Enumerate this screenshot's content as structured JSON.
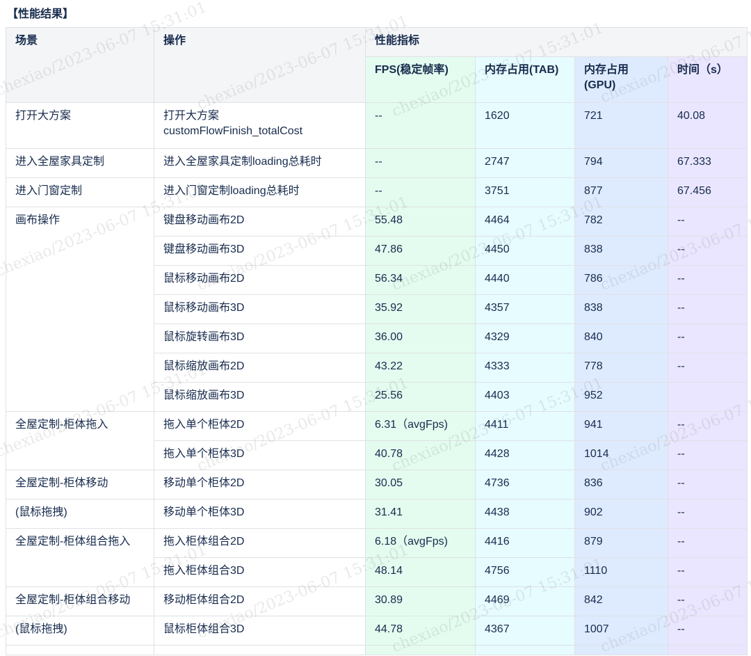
{
  "heading": "【性能结果】",
  "table": {
    "headers": {
      "scene": "场景",
      "operation": "操作",
      "metrics": "性能指标",
      "fps": "FPS(稳定帧率)",
      "mem_tab": "内存占用(TAB)",
      "mem_gpu": "内存占用\n(GPU)",
      "time": "时间（s）"
    },
    "rows": [
      {
        "scene": "打开大方案",
        "op": "打开大方案\ncustomFlowFinish_totalCost",
        "fps": "--",
        "tab": "1620",
        "gpu": "721",
        "time": "40.08"
      },
      {
        "scene": "进入全屋家具定制",
        "op": "进入全屋家具定制loading总耗时",
        "fps": "--",
        "tab": "2747",
        "gpu": "794",
        "time": "67.333"
      },
      {
        "scene": "进入门窗定制",
        "op": "进入门窗定制loading总耗时",
        "fps": "--",
        "tab": "3751",
        "gpu": "877",
        "time": "67.456"
      },
      {
        "scene": "画布操作",
        "op": "键盘移动画布2D",
        "fps": "55.48",
        "tab": "4464",
        "gpu": "782",
        "time": "--"
      },
      {
        "scene": "",
        "op": "键盘移动画布3D",
        "fps": "47.86",
        "tab": "4450",
        "gpu": "838",
        "time": "--"
      },
      {
        "scene": "",
        "op": "鼠标移动画布2D",
        "fps": "56.34",
        "tab": "4440",
        "gpu": "786",
        "time": "--"
      },
      {
        "scene": "",
        "op": "鼠标移动画布3D",
        "fps": "35.92",
        "tab": "4357",
        "gpu": "838",
        "time": "--"
      },
      {
        "scene": "",
        "op": "鼠标旋转画布3D",
        "fps": "36.00",
        "tab": "4329",
        "gpu": "840",
        "time": "--"
      },
      {
        "scene": "",
        "op": "鼠标缩放画布2D",
        "fps": "43.22",
        "tab": "4333",
        "gpu": "778",
        "time": "--"
      },
      {
        "scene": "",
        "op": "鼠标缩放画布3D",
        "fps": "25.56",
        "tab": "4403",
        "gpu": "952",
        "time": ""
      },
      {
        "scene": "全屋定制-柜体拖入",
        "op": "拖入单个柜体2D",
        "fps": "6.31（avgFps)",
        "tab": "4411",
        "gpu": "941",
        "time": "--"
      },
      {
        "scene": "",
        "op": "拖入单个柜体3D",
        "fps": "40.78",
        "tab": "4428",
        "gpu": "1014",
        "time": "--"
      },
      {
        "scene": "全屋定制-柜体移动",
        "op": "移动单个柜体2D",
        "fps": "30.05",
        "tab": "4736",
        "gpu": "836",
        "time": "--"
      },
      {
        "scene": "(鼠标拖拽)",
        "op": "移动单个柜体3D",
        "fps": "31.41",
        "tab": "4438",
        "gpu": "902",
        "time": "--"
      },
      {
        "scene": "全屋定制-柜体组合拖入",
        "op": "拖入柜体组合2D",
        "fps": "6.18（avgFps)",
        "tab": "4416",
        "gpu": "879",
        "time": "--"
      },
      {
        "scene": "",
        "op": "拖入柜体组合3D",
        "fps": "48.14",
        "tab": "4756",
        "gpu": "1110",
        "time": "--"
      },
      {
        "scene": "全屋定制-柜体组合移动",
        "op": "移动柜体组合2D",
        "fps": "30.89",
        "tab": "4469",
        "gpu": "842",
        "time": "--"
      },
      {
        "scene": "(鼠标拖拽)",
        "op": "鼠标柜体组合3D",
        "fps": "44.78",
        "tab": "4367",
        "gpu": "1007",
        "time": "--"
      },
      {
        "scene": "",
        "op": "",
        "fps": "",
        "tab": "",
        "gpu": "",
        "time": ""
      }
    ]
  },
  "watermark": "chexiao/2023-06-07 15:31:01"
}
